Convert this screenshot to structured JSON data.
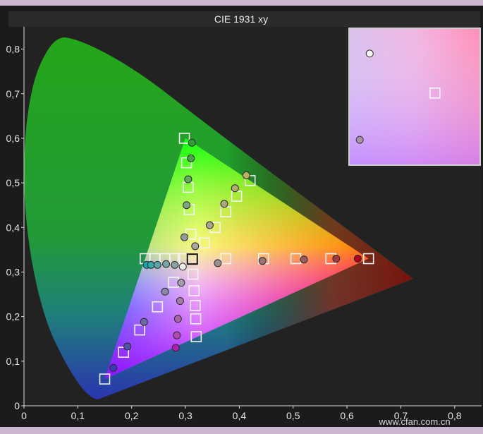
{
  "chart_data": {
    "type": "scatter",
    "title": "CIE 1931 xy",
    "xlabel": "",
    "ylabel": "",
    "xlim": [
      0,
      0.85
    ],
    "ylim": [
      0,
      0.85
    ],
    "grid": false,
    "x_ticks": [
      "0",
      "0,1",
      "0,2",
      "0,3",
      "0,4",
      "0,5",
      "0,6",
      "0,7",
      "0,8"
    ],
    "y_ticks": [
      "0",
      "0,1",
      "0,2",
      "0,3",
      "0,4",
      "0,5",
      "0,6",
      "0,7",
      "0,8"
    ],
    "white_point": {
      "x": 0.3127,
      "y": 0.329
    },
    "gamut_triangle": [
      {
        "x": 0.64,
        "y": 0.33
      },
      {
        "x": 0.3,
        "y": 0.6
      },
      {
        "x": 0.15,
        "y": 0.06
      }
    ],
    "series": [
      {
        "marker": "square",
        "points": [
          {
            "x": 0.64,
            "y": 0.33
          },
          {
            "x": 0.57,
            "y": 0.33
          },
          {
            "x": 0.505,
            "y": 0.33
          },
          {
            "x": 0.445,
            "y": 0.33
          },
          {
            "x": 0.375,
            "y": 0.33
          },
          {
            "x": 0.42,
            "y": 0.505
          },
          {
            "x": 0.395,
            "y": 0.47
          },
          {
            "x": 0.375,
            "y": 0.435
          },
          {
            "x": 0.355,
            "y": 0.4
          },
          {
            "x": 0.335,
            "y": 0.365
          },
          {
            "x": 0.298,
            "y": 0.6
          },
          {
            "x": 0.302,
            "y": 0.545
          },
          {
            "x": 0.305,
            "y": 0.49
          },
          {
            "x": 0.307,
            "y": 0.44
          },
          {
            "x": 0.31,
            "y": 0.385
          },
          {
            "x": 0.225,
            "y": 0.33
          },
          {
            "x": 0.243,
            "y": 0.33
          },
          {
            "x": 0.262,
            "y": 0.33
          },
          {
            "x": 0.28,
            "y": 0.33
          },
          {
            "x": 0.296,
            "y": 0.33
          },
          {
            "x": 0.15,
            "y": 0.06
          },
          {
            "x": 0.185,
            "y": 0.12
          },
          {
            "x": 0.215,
            "y": 0.17
          },
          {
            "x": 0.248,
            "y": 0.222
          },
          {
            "x": 0.278,
            "y": 0.277
          },
          {
            "x": 0.32,
            "y": 0.155
          },
          {
            "x": 0.319,
            "y": 0.195
          },
          {
            "x": 0.318,
            "y": 0.225
          },
          {
            "x": 0.316,
            "y": 0.258
          },
          {
            "x": 0.314,
            "y": 0.295
          },
          {
            "x": 0.3127,
            "y": 0.329
          }
        ]
      },
      {
        "marker": "circle",
        "points": [
          {
            "x": 0.62,
            "y": 0.33,
            "color": "#b3001a"
          },
          {
            "x": 0.58,
            "y": 0.33,
            "color": "#a33a3f"
          },
          {
            "x": 0.52,
            "y": 0.328,
            "color": "#9b5a5c"
          },
          {
            "x": 0.443,
            "y": 0.325,
            "color": "#9a7474"
          },
          {
            "x": 0.36,
            "y": 0.32,
            "color": "#9d8f8f"
          },
          {
            "x": 0.413,
            "y": 0.517,
            "color": "#b8b25a"
          },
          {
            "x": 0.392,
            "y": 0.488,
            "color": "#b1ad6e"
          },
          {
            "x": 0.372,
            "y": 0.453,
            "color": "#a8a67c"
          },
          {
            "x": 0.345,
            "y": 0.405,
            "color": "#a7a490"
          },
          {
            "x": 0.318,
            "y": 0.358,
            "color": "#a9a8a2"
          },
          {
            "x": 0.312,
            "y": 0.59,
            "color": "#2fa12f"
          },
          {
            "x": 0.31,
            "y": 0.555,
            "color": "#49a449"
          },
          {
            "x": 0.305,
            "y": 0.508,
            "color": "#62a862"
          },
          {
            "x": 0.302,
            "y": 0.45,
            "color": "#7aa87a"
          },
          {
            "x": 0.298,
            "y": 0.378,
            "color": "#959e95"
          },
          {
            "x": 0.228,
            "y": 0.316,
            "color": "#1aa8b4"
          },
          {
            "x": 0.236,
            "y": 0.316,
            "color": "#36a6ae"
          },
          {
            "x": 0.248,
            "y": 0.316,
            "color": "#56a6aa"
          },
          {
            "x": 0.264,
            "y": 0.318,
            "color": "#76a3a6"
          },
          {
            "x": 0.28,
            "y": 0.316,
            "color": "#8fa1a3"
          },
          {
            "x": 0.166,
            "y": 0.085,
            "color": "#3b3bb4"
          },
          {
            "x": 0.192,
            "y": 0.133,
            "color": "#5252aa"
          },
          {
            "x": 0.223,
            "y": 0.188,
            "color": "#6b6ba8"
          },
          {
            "x": 0.262,
            "y": 0.256,
            "color": "#8a8aa8"
          },
          {
            "x": 0.292,
            "y": 0.276,
            "color": "#a39aa8"
          },
          {
            "x": 0.282,
            "y": 0.13,
            "color": "#b01cb4"
          },
          {
            "x": 0.284,
            "y": 0.158,
            "color": "#b04ab2"
          },
          {
            "x": 0.286,
            "y": 0.195,
            "color": "#a865aa"
          },
          {
            "x": 0.29,
            "y": 0.235,
            "color": "#a57aa6"
          },
          {
            "x": 0.295,
            "y": 0.312,
            "color": "#f2f2f2"
          }
        ]
      }
    ],
    "inset": {
      "position": "top-right",
      "circle_points": [
        {
          "x": 0.28,
          "y": 0.345,
          "color": "#f5f5f5"
        },
        {
          "x": 0.275,
          "y": 0.31,
          "color": "#a893a6"
        }
      ],
      "square_points": [
        {
          "x": 0.3127,
          "y": 0.329
        }
      ]
    },
    "watermark": "www.cfan.com.cn"
  }
}
